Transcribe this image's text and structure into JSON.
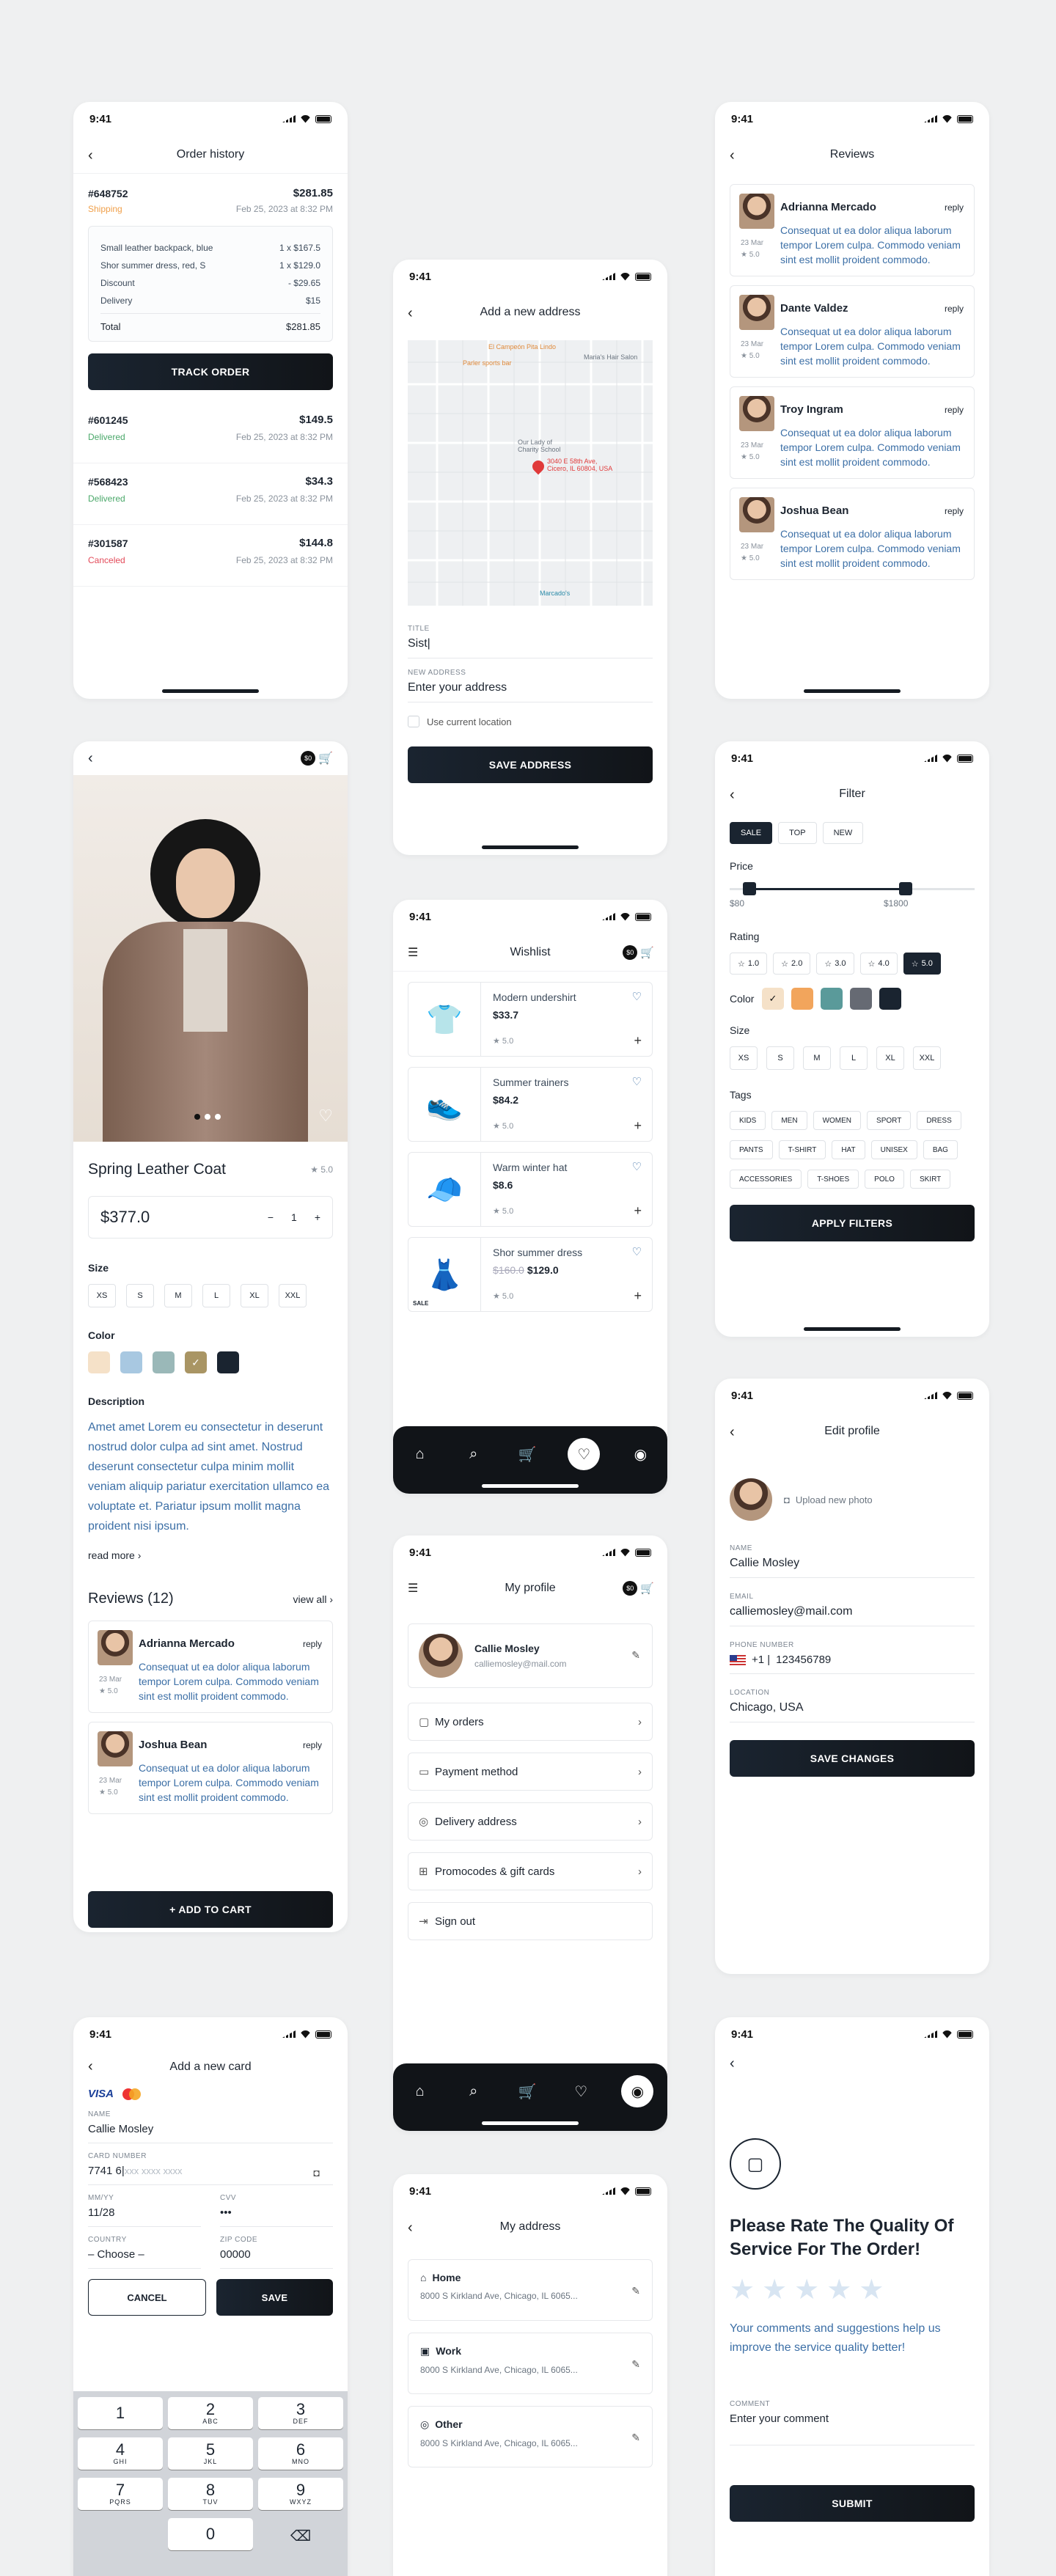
{
  "status_time": "9:41",
  "order_history": {
    "title": "Order history",
    "expanded": {
      "id": "#648752",
      "total": "$281.85",
      "status": "Shipping",
      "date": "Feb 25, 2023 at 8:32 PM",
      "lines": [
        {
          "label": "Small leather backpack, blue",
          "value": "1 x $167.5"
        },
        {
          "label": "Shor summer dress, red, S",
          "value": "1 x $129.0"
        },
        {
          "label": "Discount",
          "value": "- $29.65"
        },
        {
          "label": "Delivery",
          "value": "$15"
        }
      ],
      "total_label": "Total",
      "total_value": "$281.85",
      "track_button": "TRACK ORDER"
    },
    "orders": [
      {
        "id": "#601245",
        "total": "$149.5",
        "status": "Delivered",
        "date": "Feb 25, 2023 at 8:32 PM"
      },
      {
        "id": "#568423",
        "total": "$34.3",
        "status": "Delivered",
        "date": "Feb 25, 2023 at 8:32 PM"
      },
      {
        "id": "#301587",
        "total": "$144.8",
        "status": "Canceled",
        "date": "Feb 25, 2023 at 8:32 PM"
      }
    ]
  },
  "add_address": {
    "title": "Add a new address",
    "map_labels": [
      "El Campeón Pita Lindo",
      "Maria's Hair Salon",
      "Parler sports bar",
      "Our Lady of Charity School",
      "3040 E 58th Ave, Cicero, IL 60804, USA",
      "Marcado's"
    ],
    "title_label": "TITLE",
    "title_value": "Sist|",
    "address_label": "NEW ADDRESS",
    "address_placeholder": "Enter your address",
    "use_location": "Use current location",
    "save_button": "SAVE ADDRESS"
  },
  "reviews": {
    "title": "Reviews",
    "items": [
      {
        "name": "Adrianna Mercado",
        "reply": "reply",
        "date": "23 Mar",
        "rating": "5.0",
        "text": "Consequat ut ea dolor aliqua laborum tempor Lorem culpa. Commodo veniam sint est mollit proident commodo."
      },
      {
        "name": "Dante Valdez",
        "reply": "reply",
        "date": "23 Mar",
        "rating": "5.0",
        "text": "Consequat ut ea dolor aliqua laborum tempor Lorem culpa. Commodo veniam sint est mollit proident commodo."
      },
      {
        "name": "Troy Ingram",
        "reply": "reply",
        "date": "23 Mar",
        "rating": "5.0",
        "text": "Consequat ut ea dolor aliqua laborum tempor Lorem culpa. Commodo veniam sint est mollit proident commodo."
      },
      {
        "name": "Joshua Bean",
        "reply": "reply",
        "date": "23 Mar",
        "rating": "5.0",
        "text": "Consequat ut ea dolor aliqua laborum tempor Lorem culpa. Commodo veniam sint est mollit proident commodo."
      }
    ]
  },
  "product": {
    "cart_badge": "$0",
    "name": "Spring Leather Coat",
    "rating": "5.0",
    "price": "$377.0",
    "qty": "1",
    "minus": "−",
    "plus": "+",
    "size_label": "Size",
    "sizes": [
      "XS",
      "S",
      "M",
      "L",
      "XL",
      "XXL"
    ],
    "color_label": "Color",
    "colors": [
      "#f5e1c8",
      "#a8c8e1",
      "#9ab8b8",
      "#a99564",
      "#1a2430"
    ],
    "description_label": "Description",
    "description": "Amet amet Lorem eu consectetur in deserunt nostrud dolor culpa ad sint amet. Nostrud deserunt consectetur culpa minim mollit veniam aliquip pariatur exercitation ullamco ea voluptate et. Pariatur ipsum mollit magna proident nisi ipsum.",
    "read_more": "read more  ›",
    "reviews_title": "Reviews (12)",
    "view_all": "view  all  ›",
    "reviews": [
      {
        "name": "Adrianna Mercado",
        "reply": "reply",
        "date": "23 Mar",
        "rating": "5.0",
        "text": "Consequat ut ea dolor aliqua laborum tempor Lorem culpa. Commodo veniam sint est mollit proident commodo."
      },
      {
        "name": "Joshua Bean",
        "reply": "reply",
        "date": "23 Mar",
        "rating": "5.0",
        "text": "Consequat ut ea dolor aliqua laborum tempor Lorem culpa. Commodo veniam sint est mollit proident commodo."
      }
    ],
    "add_to_cart": "+ ADD TO CART"
  },
  "wishlist": {
    "title": "Wishlist",
    "cart_badge": "$0",
    "items": [
      {
        "name": "Modern undershirt",
        "price": "$33.7",
        "old_price": "",
        "rating": "5.0"
      },
      {
        "name": "Summer trainers",
        "price": "$84.2",
        "old_price": "",
        "rating": "5.0"
      },
      {
        "name": "Warm winter hat",
        "price": "$8.6",
        "old_price": "",
        "rating": "5.0"
      },
      {
        "name": "Shor summer dress",
        "price": "$129.0",
        "old_price": "$160.0",
        "rating": "5.0",
        "badge": "SALE"
      }
    ]
  },
  "filter": {
    "title": "Filter",
    "chips": [
      "SALE",
      "TOP",
      "NEW"
    ],
    "price_label": "Price",
    "price_min": "$80",
    "price_max": "$1800",
    "price_range_fraction": [
      0.08,
      0.72
    ],
    "rating_label": "Rating",
    "ratings": [
      "1.0",
      "2.0",
      "3.0",
      "4.0",
      "5.0"
    ],
    "color_label": "Color",
    "colors": [
      "#f5e1c8",
      "#f2a55c",
      "#5a9a9a",
      "#666a73",
      "#1a2430"
    ],
    "size_label": "Size",
    "sizes": [
      "XS",
      "S",
      "M",
      "L",
      "XL",
      "XXL"
    ],
    "tags_label": "Tags",
    "tags": [
      "KIDS",
      "MEN",
      "WOMEN",
      "SPORT",
      "DRESS",
      "PANTS",
      "T-SHIRT",
      "HAT",
      "UNISEX",
      "BAG",
      "ACCESSORIES",
      "T-SHOES",
      "POLO",
      "SKIRT"
    ],
    "apply_button": "APPLY FILTERS"
  },
  "my_profile": {
    "title": "My profile",
    "cart_badge": "$0",
    "name": "Callie Mosley",
    "email": "calliemosley@mail.com",
    "menu": [
      "My orders",
      "Payment method",
      "Delivery address",
      "Promocodes & gift cards",
      "Sign out"
    ]
  },
  "edit_profile": {
    "title": "Edit profile",
    "upload": "Upload new photo",
    "name_label": "NAME",
    "name": "Callie Mosley",
    "email_label": "EMAIL",
    "email": "calliemosley@mail.com",
    "phone_label": "PHONE NUMBER",
    "phone_code": "+1 |",
    "phone": "123456789",
    "location_label": "LOCATION",
    "location": "Chicago, USA",
    "save_button": "SAVE CHANGES"
  },
  "add_card": {
    "title": "Add a new card",
    "visa": "VISA",
    "name_label": "NAME",
    "name": "Callie Mosley",
    "card_label": "CARD NUMBER",
    "card_value": "7741 6|",
    "card_placeholder": "xxx  xxxx  xxxx",
    "mmyy_label": "MM/YY",
    "mmyy": "11/28",
    "cvv_label": "CVV",
    "cvv": "•••",
    "country_label": "COUNTRY",
    "country": "– Choose –",
    "zip_label": "ZIP CODE",
    "zip_placeholder": "00000",
    "cancel": "CANCEL",
    "save": "SAVE",
    "keys": [
      {
        "n": "1",
        "l": ""
      },
      {
        "n": "2",
        "l": "ABC"
      },
      {
        "n": "3",
        "l": "DEF"
      },
      {
        "n": "4",
        "l": "GHI"
      },
      {
        "n": "5",
        "l": "JKL"
      },
      {
        "n": "6",
        "l": "MNO"
      },
      {
        "n": "7",
        "l": "PQRS"
      },
      {
        "n": "8",
        "l": "TUV"
      },
      {
        "n": "9",
        "l": "WXYZ"
      },
      {
        "n": "0",
        "l": ""
      }
    ]
  },
  "my_address": {
    "title": "My address",
    "items": [
      {
        "label": "Home",
        "address": "8000 S Kirkland Ave, Chicago, IL 6065..."
      },
      {
        "label": "Work",
        "address": "8000 S Kirkland Ave, Chicago, IL 6065..."
      },
      {
        "label": "Other",
        "address": "8000 S Kirkland Ave, Chicago, IL 6065..."
      }
    ]
  },
  "rate": {
    "title": "Please Rate The Quality Of Service For The Order!",
    "text": "Your comments and suggestions help us improve the service quality better!",
    "comment_label": "COMMENT",
    "comment_placeholder": "Enter your comment",
    "submit": "SUBMIT"
  }
}
